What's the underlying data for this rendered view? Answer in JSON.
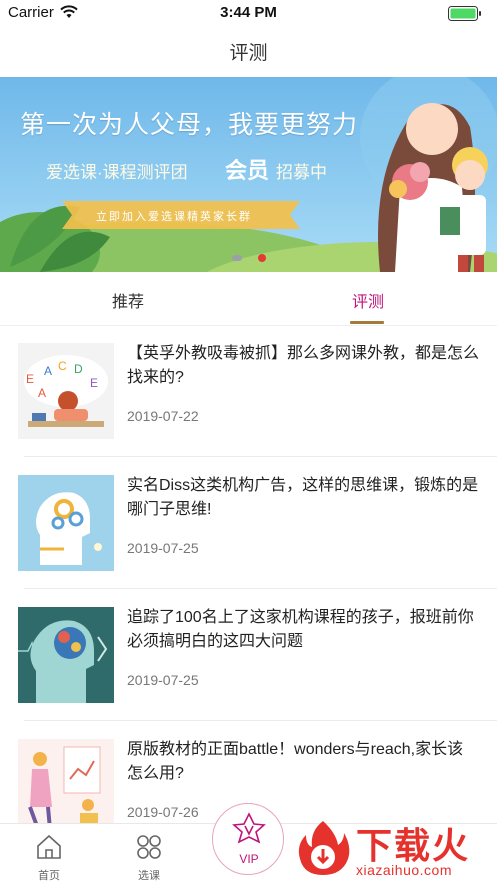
{
  "status_bar": {
    "carrier": "Carrier",
    "time": "3:44 PM",
    "icons": [
      "wifi-icon",
      "battery-icon"
    ]
  },
  "nav": {
    "title": "评测"
  },
  "banner": {
    "headline": "第一次为人父母，我要更努力",
    "sub_prefix": "爱选课·课程测评团",
    "sub_accent": "会员",
    "sub_suffix": "招募中",
    "ribbon": "立即加入爱选课精英家长群",
    "slide_count": 2,
    "active_slide": 2
  },
  "tabs": [
    {
      "label": "推荐",
      "active": false
    },
    {
      "label": "评测",
      "active": true
    }
  ],
  "articles": [
    {
      "title": "【英孚外教吸毒被抓】那么多网课外教，都是怎么找来的?",
      "date": "2019-07-22",
      "thumb": "letters-study-illustration"
    },
    {
      "title": "实名Diss这类机构广告，这样的思维课，锻炼的是哪门子思维!",
      "date": "2019-07-25",
      "thumb": "head-gears-illustration"
    },
    {
      "title": "追踪了100名上了这家机构课程的孩子，报班前你必须搞明白的这四大问题",
      "date": "2019-07-25",
      "thumb": "brain-profile-illustration"
    },
    {
      "title": "原版教材的正面battle！wonders与reach,家长该怎么用?",
      "date": "2019-07-26",
      "thumb": "presentation-illustration"
    }
  ],
  "tabbar": {
    "items": [
      {
        "label": "首页",
        "icon": "home-icon"
      },
      {
        "label": "选课",
        "icon": "grid-icon"
      }
    ],
    "vip_label": "VIP"
  },
  "watermark": {
    "cn": "下载火",
    "en": "xiazaihuo.com"
  },
  "colors": {
    "accent_pink": "#c0147a",
    "tab_underline": "#a37b3d",
    "banner_blue": "#7ec3ec",
    "watermark_red": "#e5322d"
  }
}
